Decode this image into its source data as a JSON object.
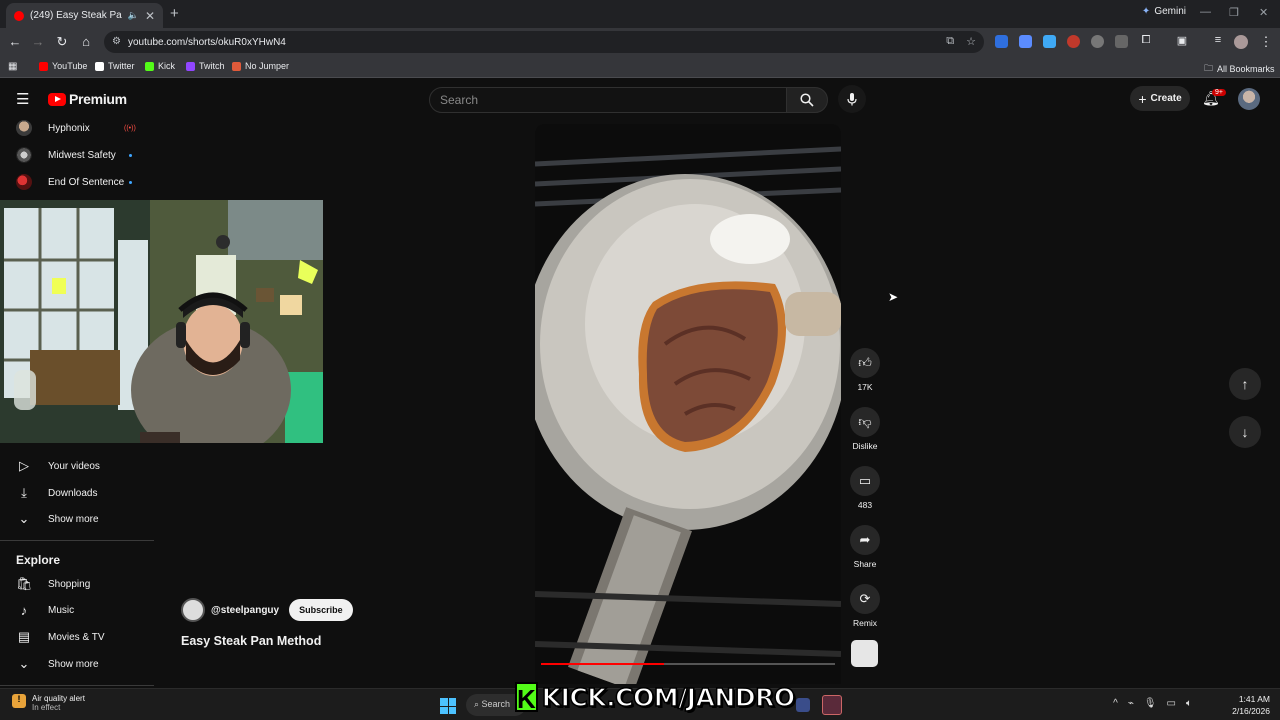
{
  "browser": {
    "tab_title": "(249) Easy Steak Pan Meth...",
    "tab_close": "✕",
    "new_tab": "+",
    "gemini_label": "Gemini",
    "url": "youtube.com/shorts/okuR0xYHwN4",
    "bookmarks": [
      {
        "label": "YouTube",
        "color": "#ff0000"
      },
      {
        "label": "Twitter",
        "color": "#ffffff"
      },
      {
        "label": "Kick",
        "color": "#53fc18"
      },
      {
        "label": "Twitch",
        "color": "#9146ff"
      },
      {
        "label": "No Jumper",
        "color": "#e05a3a"
      }
    ],
    "all_bookmarks": "All Bookmarks"
  },
  "header": {
    "logo_text": "Premium",
    "search_placeholder": "Search",
    "create_label": "Create",
    "notification_count": "9+"
  },
  "sidebar": {
    "subscriptions": [
      {
        "name": "Hyphonix",
        "live": true
      },
      {
        "name": "Midwest Safety",
        "live": false
      },
      {
        "name": "End Of Sentence",
        "live": false
      }
    ],
    "nav": [
      {
        "label": "Your videos",
        "icon": "play-square-icon"
      },
      {
        "label": "Downloads",
        "icon": "download-icon"
      },
      {
        "label": "Show more",
        "icon": "chevron-down-icon"
      }
    ],
    "explore_heading": "Explore",
    "explore": [
      {
        "label": "Shopping",
        "icon": "bag-icon"
      },
      {
        "label": "Music",
        "icon": "music-note-icon"
      },
      {
        "label": "Movies & TV",
        "icon": "film-icon"
      },
      {
        "label": "Show more",
        "icon": "chevron-down-icon"
      }
    ]
  },
  "short": {
    "channel": "@steelpanguy",
    "subscribe_label": "Subscribe",
    "title": "Easy Steak Pan Method",
    "progress": 0.42,
    "likes": "17K",
    "dislike_label": "Dislike",
    "comments": "483",
    "share_label": "Share",
    "remix_label": "Remix"
  },
  "taskbar": {
    "alert_title": "Air quality alert",
    "alert_sub": "In effect",
    "search_label": "Search",
    "overlay_text": "KICK.COM/JANDRO",
    "overlay_k": "K",
    "time": "1:41 AM",
    "date": "2/16/2026"
  }
}
